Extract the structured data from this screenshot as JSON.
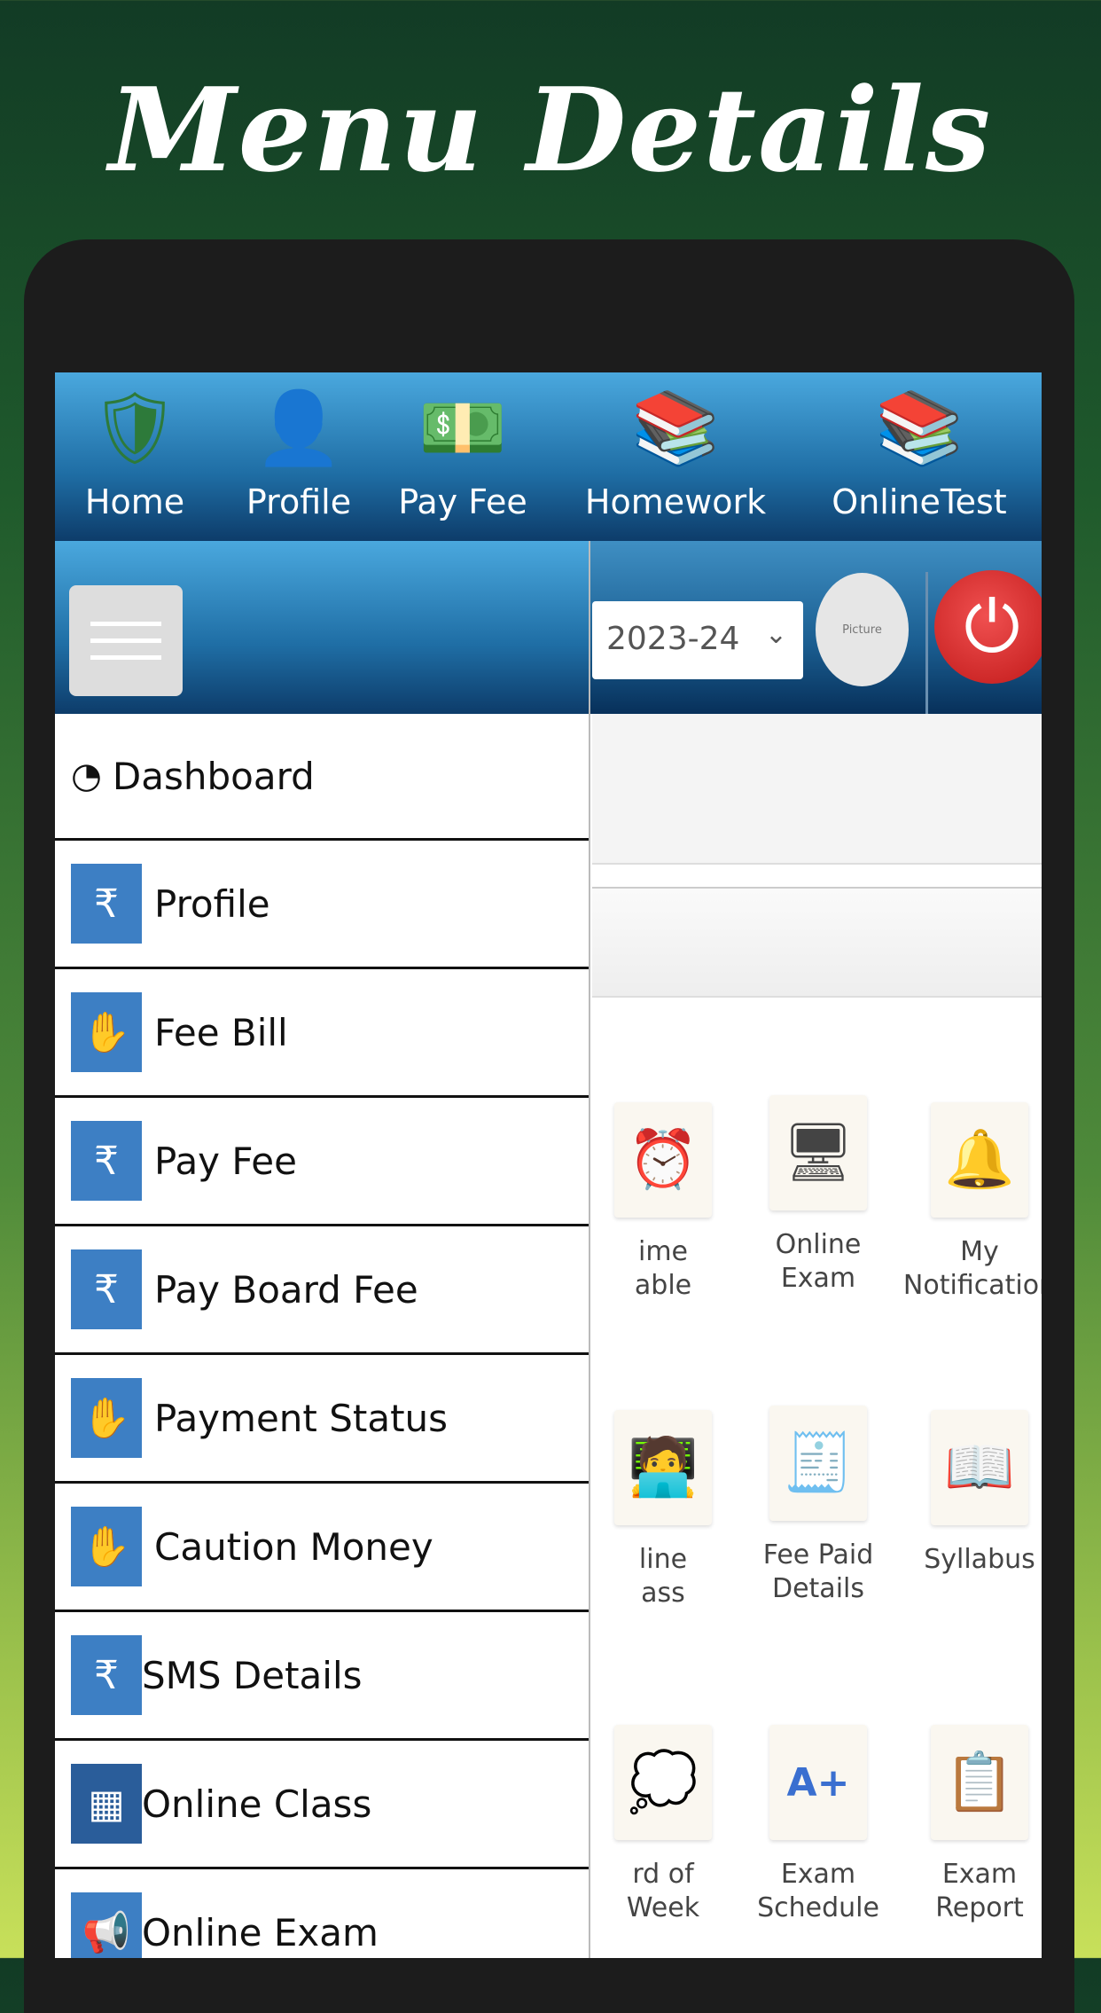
{
  "title": "Menu Details",
  "topnav": [
    {
      "label": "Home",
      "icon": "school-emblem-icon"
    },
    {
      "label": "Profile",
      "icon": "person-icon"
    },
    {
      "label": "Pay Fee",
      "icon": "money-icon"
    },
    {
      "label": "Homework",
      "icon": "books-icon"
    },
    {
      "label": "OnlineTest",
      "icon": "book-stack-icon"
    }
  ],
  "header": {
    "session": "2023-24",
    "picture": "Picture"
  },
  "drawer": {
    "items": [
      {
        "label": "Dashboard",
        "icon": "dashboard-gauge-icon"
      },
      {
        "label": "Profile",
        "icon": "student-fee-icon"
      },
      {
        "label": "Fee Bill",
        "icon": "hand-card-icon"
      },
      {
        "label": "Pay Fee",
        "icon": "student-fee-icon"
      },
      {
        "label": "Pay Board Fee",
        "icon": "student-fee-icon"
      },
      {
        "label": "Payment Status",
        "icon": "hand-card-icon"
      },
      {
        "label": "Caution Money",
        "icon": "hand-card-icon"
      },
      {
        "label": "SMS Details",
        "icon": "student-fee-icon"
      },
      {
        "label": "Online Class",
        "icon": "timetable-icon"
      },
      {
        "label": "Online Exam",
        "icon": "megaphone-icon"
      }
    ]
  },
  "tiles": [
    {
      "label": "ime\nable",
      "icon": "clock-calendar-icon"
    },
    {
      "label": "Online\nExam",
      "icon": "computer-exam-icon"
    },
    {
      "label": "My\nNotification",
      "icon": "bell-icon"
    },
    {
      "label": "line\nass",
      "icon": "online-class-icon"
    },
    {
      "label": "Fee Paid\nDetails",
      "icon": "receipt-icon"
    },
    {
      "label": "Syllabus",
      "icon": "open-book-icon"
    },
    {
      "label": "rd of\nWeek",
      "icon": "thought-icon"
    },
    {
      "label": "Exam\nSchedule",
      "icon": "grade-paper-icon"
    },
    {
      "label": "Exam\nReport",
      "icon": "clipboard-icon"
    }
  ]
}
